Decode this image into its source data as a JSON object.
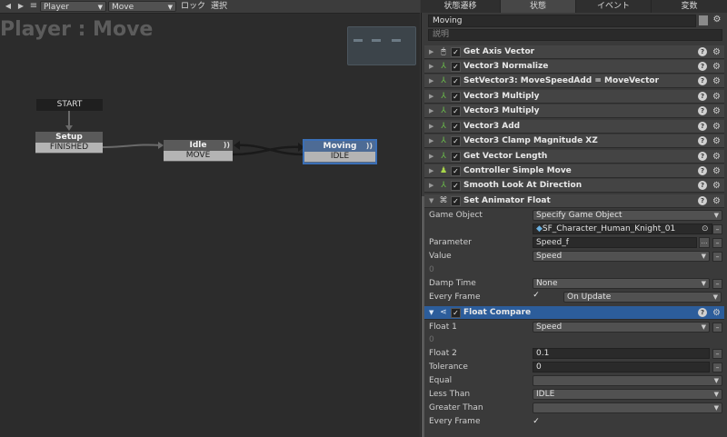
{
  "toolbar": {
    "back_icon": "arrow-left-icon",
    "forward_icon": "arrow-right-icon",
    "menu_icon": "hamburger-icon",
    "object_select": "Player",
    "fsm_select": "Move",
    "lock_label": "ロック",
    "select_label": "選択"
  },
  "graph": {
    "title": "Player : Move",
    "nodes": {
      "start": {
        "header": "START"
      },
      "setup": {
        "header": "Setup",
        "event": "FINISHED"
      },
      "idle": {
        "header": "Idle",
        "event": "MOVE"
      },
      "moving": {
        "header": "Moving",
        "event": "IDLE"
      }
    }
  },
  "panel": {
    "tabs": [
      "状態遷移",
      "状態",
      "イベント",
      "変数"
    ],
    "active_tab": 1,
    "state_name": "Moving",
    "description_placeholder": "説明",
    "actions": [
      {
        "label": "Get Axis Vector",
        "icon": "mouse-icon"
      },
      {
        "label": "Vector3 Normalize",
        "icon": "axis-icon"
      },
      {
        "label": "SetVector3: MoveSpeedAdd = MoveVector",
        "icon": "axis-icon"
      },
      {
        "label": "Vector3 Multiply",
        "icon": "axis-icon"
      },
      {
        "label": "Vector3 Multiply",
        "icon": "axis-icon"
      },
      {
        "label": "Vector3 Add",
        "icon": "axis-icon"
      },
      {
        "label": "Vector3 Clamp Magnitude XZ",
        "icon": "axis-icon"
      },
      {
        "label": "Get Vector Length",
        "icon": "axis-icon"
      },
      {
        "label": "Controller Simple Move",
        "icon": "character-icon"
      },
      {
        "label": "Smooth Look At Direction",
        "icon": "axis-icon"
      }
    ],
    "animator_action": {
      "label": "Set Animator Float",
      "game_object_label": "Game Object",
      "game_object_value": "Specify Game Object",
      "object_ref": "SF_Character_Human_Knight_01",
      "parameter_label": "Parameter",
      "parameter_value": "Speed_f",
      "value_label": "Value",
      "value_value": "Speed",
      "value_zero": "0",
      "damp_label": "Damp Time",
      "damp_value": "None",
      "every_frame_label": "Every Frame",
      "update_value": "On Update"
    },
    "compare_action": {
      "label": "Float Compare",
      "float1_label": "Float 1",
      "float1_value": "Speed",
      "float1_zero": "0",
      "float2_label": "Float 2",
      "float2_value": "0.1",
      "tolerance_label": "Tolerance",
      "tolerance_value": "0",
      "equal_label": "Equal",
      "equal_value": "",
      "less_label": "Less Than",
      "less_value": "IDLE",
      "greater_label": "Greater Than",
      "greater_value": "",
      "every_frame_label": "Every Frame"
    }
  },
  "colors": {
    "canvas": "#2c2c2c",
    "selected_node_border": "#3b6fb6",
    "selected_action": "#2c5d9b",
    "axis_icon": "#6cc24a"
  }
}
